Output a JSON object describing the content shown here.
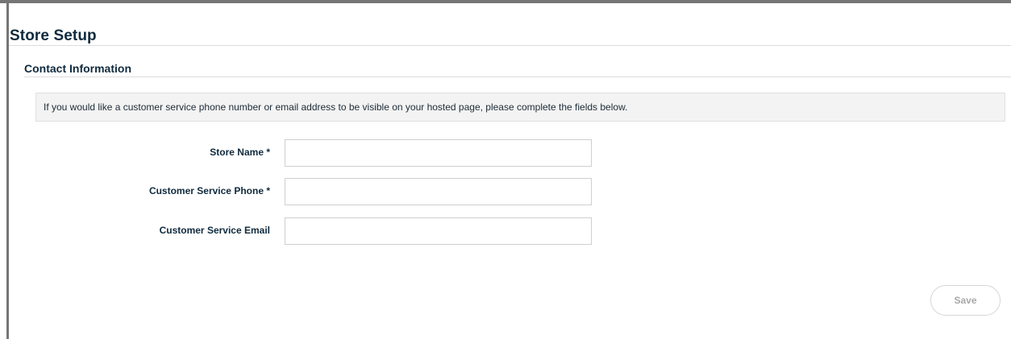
{
  "page": {
    "title": "Store Setup"
  },
  "section": {
    "title": "Contact Information",
    "info_text": "If you would like a customer service phone number or email address to be visible on your hosted page, please complete the fields below."
  },
  "form": {
    "fields": [
      {
        "label": "Store Name *",
        "value": "",
        "placeholder": "",
        "required": true
      },
      {
        "label": "Customer Service Phone *",
        "value": "",
        "placeholder": "",
        "required": true
      },
      {
        "label": "Customer Service Email",
        "value": "",
        "placeholder": "",
        "required": false
      }
    ],
    "save_label": "Save"
  },
  "colors": {
    "frame": "#767676",
    "heading": "#0f2a3d",
    "info_background": "#f3f3f3",
    "input_border": "#cfcfcf",
    "save_text_disabled": "#a8a8a8"
  }
}
